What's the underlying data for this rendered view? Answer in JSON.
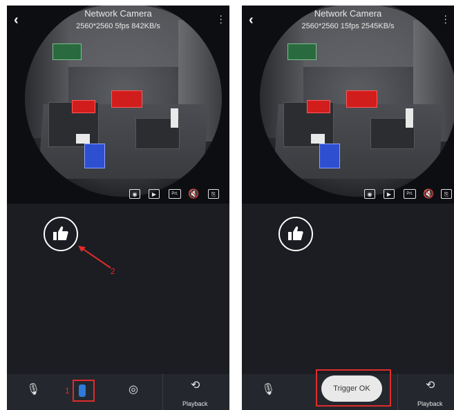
{
  "left_screen": {
    "title": "Network Camera",
    "stats": "2560*2560  5fps  842KB/s",
    "playback_label": "Playback",
    "annotation_1": "1",
    "annotation_2": "2"
  },
  "right_screen": {
    "title": "Network Camera",
    "stats": "2560*2560  15fps  2545KB/s",
    "playback_label": "Playback",
    "toast": "Trigger OK"
  },
  "icons": {
    "back": "back-chevron-icon",
    "menu": "more-vertical-icon",
    "snapshot": "camera-icon",
    "record": "record-video-icon",
    "prt": "prt-icon",
    "mute": "speaker-mute-icon",
    "fullscreen": "fullscreen-icon",
    "mic": "microphone-icon",
    "touch": "hand-touch-icon",
    "ptz": "ptz-icon",
    "playback": "playback-icon",
    "like": "thumbs-up-icon"
  },
  "colors": {
    "annotation_red": "#e32b2b",
    "toast_bg": "#e9e9e9"
  }
}
